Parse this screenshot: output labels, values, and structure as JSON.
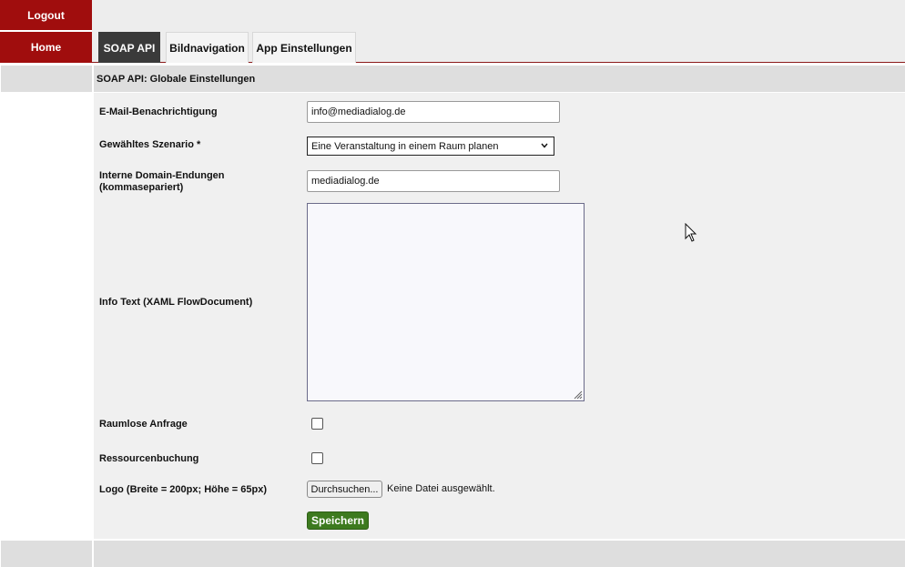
{
  "nav": {
    "logout": "Logout",
    "home": "Home"
  },
  "tabs": [
    {
      "label": "SOAP API",
      "active": true
    },
    {
      "label": "Bildnavigation",
      "active": false
    },
    {
      "label": "App Einstellungen",
      "active": false
    }
  ],
  "section": {
    "title": "SOAP API: Globale Einstellungen"
  },
  "form": {
    "email": {
      "label": "E-Mail-Benachrichtigung",
      "value": "info@mediadialog.de"
    },
    "scenario": {
      "label": "Gewähltes Szenario *",
      "value": "Eine Veranstaltung in einem Raum planen"
    },
    "domains": {
      "label_line1": "Interne Domain-Endungen",
      "label_line2": "(kommasepariert)",
      "value": "mediadialog.de"
    },
    "info_text": {
      "label": "Info Text (XAML FlowDocument)",
      "value": ""
    },
    "raumlos": {
      "label": "Raumlose Anfrage",
      "checked": false
    },
    "ressource": {
      "label": "Ressourcenbuchung",
      "checked": false
    },
    "logo": {
      "label": "Logo (Breite = 200px; Höhe = 65px)",
      "button": "Durchsuchen...",
      "status": "Keine Datei ausgewählt."
    },
    "save": "Speichern"
  },
  "colors": {
    "nav_red": "#a00d0d",
    "save_green": "#3d7a1f",
    "active_tab": "#3a3a3a"
  }
}
